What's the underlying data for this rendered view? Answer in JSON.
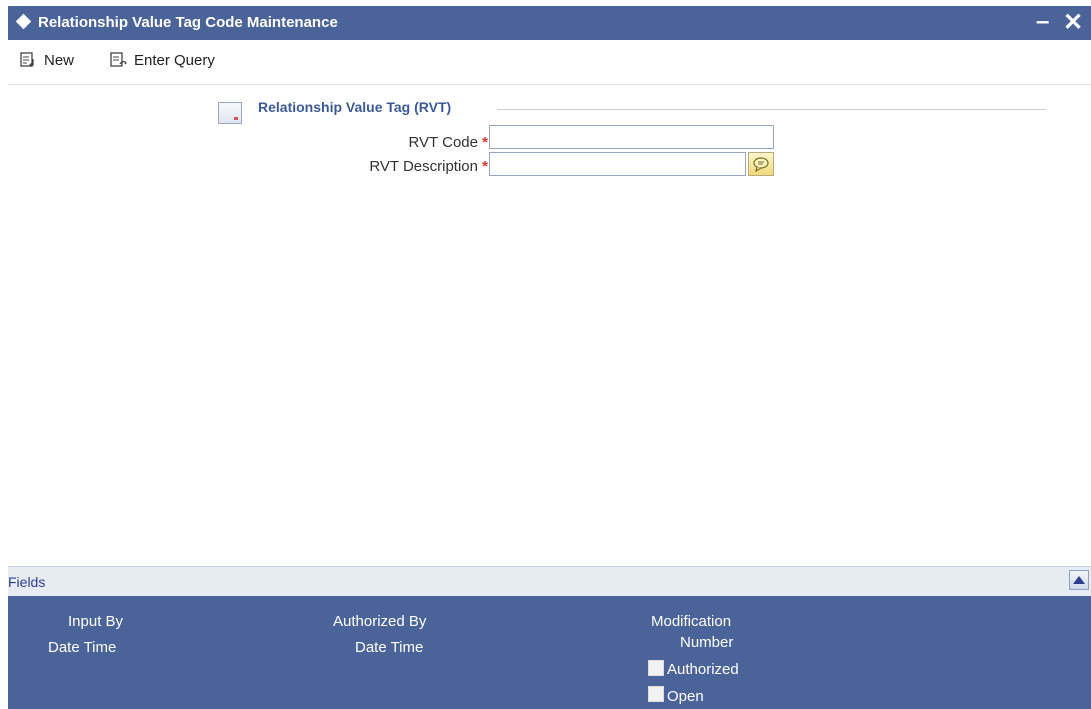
{
  "window": {
    "title": "Relationship Value Tag Code Maintenance",
    "minimize_glyph": "–",
    "close_glyph": "✕"
  },
  "toolbar": {
    "new_label": "New",
    "enter_query_label": "Enter Query"
  },
  "section": {
    "title": "Relationship Value Tag (RVT)"
  },
  "form": {
    "rvt_code": {
      "label": "RVT Code",
      "required_mark": "*",
      "value": ""
    },
    "rvt_description": {
      "label": "RVT Description",
      "required_mark": "*",
      "value": ""
    }
  },
  "fields_bar": {
    "label": "Fields"
  },
  "audit": {
    "input_by": "Input By",
    "date_time_1": "Date Time",
    "authorized_by": "Authorized By",
    "date_time_2": "Date Time",
    "modification": "Modification",
    "number": "Number",
    "authorized": "Authorized",
    "open": "Open"
  },
  "colors": {
    "title_bar": "#4a6399",
    "audit_bg": "#4a6399",
    "section_title": "#3d5a98",
    "required": "#d9342b"
  }
}
